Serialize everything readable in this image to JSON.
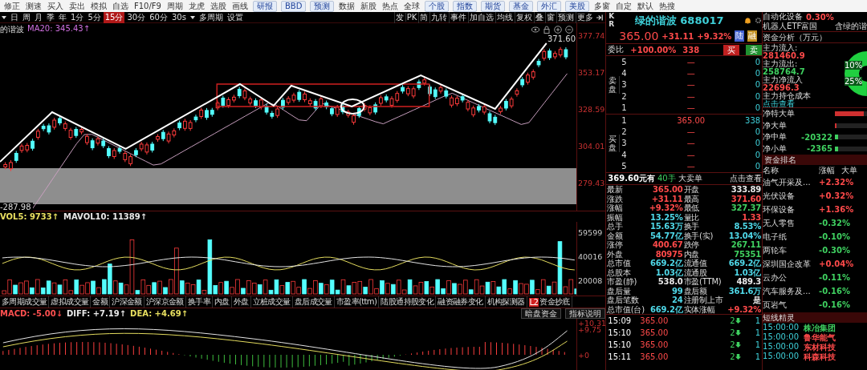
{
  "toolbar": {
    "items": [
      {
        "label": "修正",
        "kind": "tool"
      },
      {
        "label": "测速",
        "kind": "tool"
      },
      {
        "label": "买入",
        "kind": "tool"
      },
      {
        "label": "卖出",
        "kind": "tool"
      },
      {
        "label": "模拟",
        "kind": "tool"
      },
      {
        "label": "自选",
        "kind": "tool"
      },
      {
        "label": "F10/F9",
        "kind": "tool"
      },
      {
        "label": "周期",
        "kind": "tool"
      },
      {
        "label": "龙虎",
        "kind": "tool"
      },
      {
        "label": "选股",
        "kind": "tool"
      },
      {
        "label": "画线",
        "kind": "tool"
      },
      {
        "label": "研报",
        "kind": "button"
      },
      {
        "label": "BBD",
        "kind": "button"
      },
      {
        "label": "预测",
        "kind": "button"
      },
      {
        "label": "数据",
        "kind": "tool"
      },
      {
        "label": "新股",
        "kind": "tool"
      },
      {
        "label": "热点",
        "kind": "tool"
      },
      {
        "label": "全球",
        "kind": "tool"
      },
      {
        "label": "个股",
        "kind": "button"
      },
      {
        "label": "指数",
        "kind": "button"
      },
      {
        "label": "期货",
        "kind": "button"
      },
      {
        "label": "基金",
        "kind": "button"
      },
      {
        "label": "外汇",
        "kind": "button"
      },
      {
        "label": "美股",
        "kind": "button"
      },
      {
        "label": "多窗",
        "kind": "tool"
      },
      {
        "label": "自定",
        "kind": "tool"
      },
      {
        "label": "默认",
        "kind": "tool"
      },
      {
        "label": "热搜",
        "kind": "tool"
      }
    ]
  },
  "period_bar": {
    "periods": [
      {
        "label": "日",
        "selected": false
      },
      {
        "label": "周",
        "selected": false
      },
      {
        "label": "月",
        "selected": false
      },
      {
        "label": "季",
        "selected": false
      },
      {
        "label": "年",
        "selected": false
      },
      {
        "label": "1分",
        "selected": false
      },
      {
        "label": "5分",
        "selected": false
      },
      {
        "label": "15分",
        "selected": true
      },
      {
        "label": "30分",
        "selected": false
      },
      {
        "label": "60分",
        "selected": false
      },
      {
        "label": "30s",
        "selected": false
      }
    ],
    "extra": [
      "多周期",
      "设置"
    ],
    "tools": [
      "发",
      "PK",
      "简",
      "九转",
      "事件",
      "加自选",
      "均线",
      "复权",
      "叠",
      "窗",
      "预测",
      "更多"
    ]
  },
  "chart": {
    "stock_label": "的谐波",
    "ma_label": "MA20: 345.43↑",
    "price_ticks": [
      "377.74",
      "353.17",
      "328.59",
      "304.01",
      "279.43"
    ],
    "high_marker": "371.60",
    "low_marker": "-287.98"
  },
  "volume": {
    "legend": [
      {
        "text": "VOL5: 9733↑",
        "color": "#e8e060"
      },
      {
        "text": "MAVOL10: 11389↑",
        "color": "#e8e8e8"
      }
    ],
    "ticks": [
      "59599",
      "40016",
      "20008"
    ]
  },
  "indicator_tabs": [
    {
      "label": "多周期成交量"
    },
    {
      "label": "虚拟成交量"
    },
    {
      "label": "金额"
    },
    {
      "label": "沪深金额"
    },
    {
      "label": "沪深京金额"
    },
    {
      "label": "换手率"
    },
    {
      "label": "内盘"
    },
    {
      "label": "外盘"
    },
    {
      "label": "立桩成交量"
    },
    {
      "label": "盘后成交量"
    },
    {
      "label": "市盈率(ttm)"
    },
    {
      "label": "陆股通持股变化"
    },
    {
      "label": "融资融券变化"
    },
    {
      "label": "机构探测器"
    },
    {
      "label": "资金抄底",
      "badge": "L2"
    }
  ],
  "macd": {
    "legend": [
      {
        "text": "MACD: -5.00↓",
        "color": "#ff5050"
      },
      {
        "text": "DIFF: +7.19↑",
        "color": "#e8e8e8"
      },
      {
        "text": "DEA: +4.69↑",
        "color": "#e8e060"
      }
    ],
    "buttons": [
      "暗盘资金",
      "指标说明"
    ],
    "ticks": [
      "+10.31",
      "+9.75",
      "+0"
    ]
  },
  "quote": {
    "kr": [
      "K",
      "R"
    ],
    "name": "绿的谐波 688017",
    "price": "365.00",
    "change": "+31.11",
    "change_pct": "+9.32%",
    "badges": [
      "陆",
      "融"
    ],
    "weibi_label": "委比",
    "weibi": "+100.00%",
    "weibi_vol": "338",
    "trade_buttons": [
      {
        "label": "买",
        "kind": "buy"
      },
      {
        "label": "卖",
        "kind": "sell"
      }
    ],
    "sell_label": "卖盘",
    "sell_levels": [
      {
        "level": "5",
        "price": "—",
        "volume": "0"
      },
      {
        "level": "4",
        "price": "—",
        "volume": "0"
      },
      {
        "level": "3",
        "price": "—",
        "volume": "0"
      },
      {
        "level": "2",
        "price": "—",
        "volume": "0"
      },
      {
        "level": "1",
        "price": "—",
        "volume": "0"
      }
    ],
    "buy_label": "买盘",
    "buy_levels": [
      {
        "level": "1",
        "price": "365.00",
        "volume": "338"
      },
      {
        "level": "2",
        "price": "—",
        "volume": "0"
      },
      {
        "level": "3",
        "price": "—",
        "volume": "0"
      },
      {
        "level": "4",
        "price": "—",
        "volume": "0"
      },
      {
        "level": "5",
        "price": "—",
        "volume": "0"
      }
    ],
    "big_order": {
      "price": "369.60元有",
      "lots": "40手",
      "type": "大卖单",
      "link": "点击查看"
    },
    "stats": [
      {
        "label": "最新",
        "value": "365.00",
        "color": "#ff4a4a"
      },
      {
        "label": "开盘",
        "value": "333.89",
        "color": "#e8e8e8"
      },
      {
        "label": "涨跌",
        "value": "+31.11",
        "color": "#ff4a4a"
      },
      {
        "label": "最高",
        "value": "371.60",
        "color": "#ff4a4a"
      },
      {
        "label": "涨幅",
        "value": "+9.32%",
        "color": "#ff4a4a"
      },
      {
        "label": "最低",
        "value": "327.37",
        "color": "#3fd060"
      },
      {
        "label": "振幅",
        "value": "13.25%",
        "color": "#4fd8e8"
      },
      {
        "label": "量比",
        "value": "1.33",
        "color": "#ff4a4a"
      },
      {
        "label": "总手",
        "value": "15.63万",
        "color": "#4fd8e8"
      },
      {
        "label": "换手",
        "value": "8.53%",
        "color": "#4fd8e8"
      },
      {
        "label": "金额",
        "value": "54.77亿",
        "color": "#4fd8e8"
      },
      {
        "label": "换手(实)",
        "value": "13.04%",
        "color": "#4fd8e8"
      },
      {
        "label": "涨停",
        "value": "400.67",
        "color": "#ff4a4a"
      },
      {
        "label": "跌停",
        "value": "267.11",
        "color": "#3fd060"
      },
      {
        "label": "外盘",
        "value": "80975",
        "color": "#ff4a4a"
      },
      {
        "label": "内盘",
        "value": "75351",
        "color": "#3fd060"
      },
      {
        "label": "总市值",
        "value": "669.2亿",
        "color": "#4fd8e8"
      },
      {
        "label": "流通值",
        "value": "669.2亿",
        "color": "#4fd8e8"
      },
      {
        "label": "总股本",
        "value": "1.03亿",
        "color": "#4fd8e8"
      },
      {
        "label": "流通股",
        "value": "1.03亿",
        "color": "#4fd8e8"
      },
      {
        "label": "市盈(静)",
        "value": "538.0",
        "color": "#e8e8e8"
      },
      {
        "label": "市盈(TTM)",
        "value": "489.3",
        "color": "#e8e8e8"
      },
      {
        "label": "盘后量",
        "value": "99",
        "color": "#4fd8e8"
      },
      {
        "label": "盘后额",
        "value": "361.6万",
        "color": "#4fd8e8"
      },
      {
        "label": "盘后笔数",
        "value": "24",
        "color": "#4fd8e8"
      },
      {
        "label": "注册制上市",
        "value": "是",
        "color": "#e8e8e8"
      },
      {
        "label": "总市值(台)",
        "value": "669.2亿",
        "color": "#4fd8e8"
      },
      {
        "label": "实体涨幅",
        "value": "+9.32%",
        "color": "#ff4a4a"
      }
    ],
    "ticks": [
      {
        "time": "15:09",
        "price": "365.00",
        "volume": "2",
        "count": "1"
      },
      {
        "time": "15:10",
        "price": "365.00",
        "volume": "2",
        "count": "1"
      },
      {
        "time": "15:10",
        "price": "365.00",
        "volume": "2",
        "count": "1"
      },
      {
        "time": "15:11",
        "price": "365.00",
        "volume": "2",
        "count": "1"
      }
    ]
  },
  "sector": {
    "industry": "自动化设备",
    "industry_change": "0.30%",
    "etf": "机器人ETF富国",
    "etf_note": "含绿的谐",
    "fund_title": "资金分析（万元）",
    "flows": [
      {
        "label": "主力流入:",
        "value": "281460.9",
        "color": "#ff4a4a"
      },
      {
        "label": "主力流出:",
        "value": "258764.7",
        "color": "#3fd060"
      },
      {
        "label": "主力净流入",
        "value": "22696.3",
        "color": "#ff4a4a"
      }
    ],
    "cost_label": "主力持仓成本",
    "cost_link": "点击查看",
    "donut_labels": [
      "10%",
      "25%"
    ],
    "net": [
      {
        "label": "净特大单",
        "level": 0.9,
        "color": "#d03030"
      },
      {
        "label": "净大单",
        "level": 0.06,
        "color": "#d03030"
      },
      {
        "label": "净中单",
        "value": "-20322",
        "level": 0.1,
        "color": "#3fd060"
      },
      {
        "label": "净小单",
        "value": "-2365",
        "level": 0.1,
        "color": "#3fd060"
      }
    ],
    "rank_title": "资金排名",
    "rank_columns": [
      "名称",
      "涨幅",
      "大单"
    ],
    "rank": [
      {
        "name": "油气开采及...",
        "change": "+2.32%",
        "color": "#ff4a4a"
      },
      {
        "name": "光伏设备",
        "change": "+0.32%",
        "color": "#ff4a4a"
      },
      {
        "name": "环保设备",
        "change": "+1.36%",
        "color": "#ff4a4a"
      },
      {
        "name": "无人零售",
        "change": "-0.32%",
        "color": "#3fd060"
      },
      {
        "name": "电子纸",
        "change": "-0.10%",
        "color": "#3fd060"
      },
      {
        "name": "两轮车",
        "change": "-0.30%",
        "color": "#3fd060"
      },
      {
        "name": "深圳国企改革",
        "change": "+0.04%",
        "color": "#ff4a4a"
      },
      {
        "name": "云办公",
        "change": "-0.11%",
        "color": "#3fd060"
      },
      {
        "name": "汽车服务及...",
        "change": "-0.16%",
        "color": "#3fd060"
      },
      {
        "name": "页岩气",
        "change": "-0.16%",
        "color": "#3fd060"
      }
    ],
    "short_title": "短线精灵",
    "short_rows": [
      {
        "time": "15:00:00",
        "name": "株冶集团",
        "color": "#3fd060"
      },
      {
        "time": "15:00:00",
        "name": "鲁华能气",
        "color": "#ff4a4a"
      },
      {
        "time": "15:00:00",
        "name": "东材科技",
        "color": "#ff4a4a"
      },
      {
        "time": "15:00:00",
        "name": "科森科技",
        "color": "#ff4a4a"
      }
    ]
  }
}
